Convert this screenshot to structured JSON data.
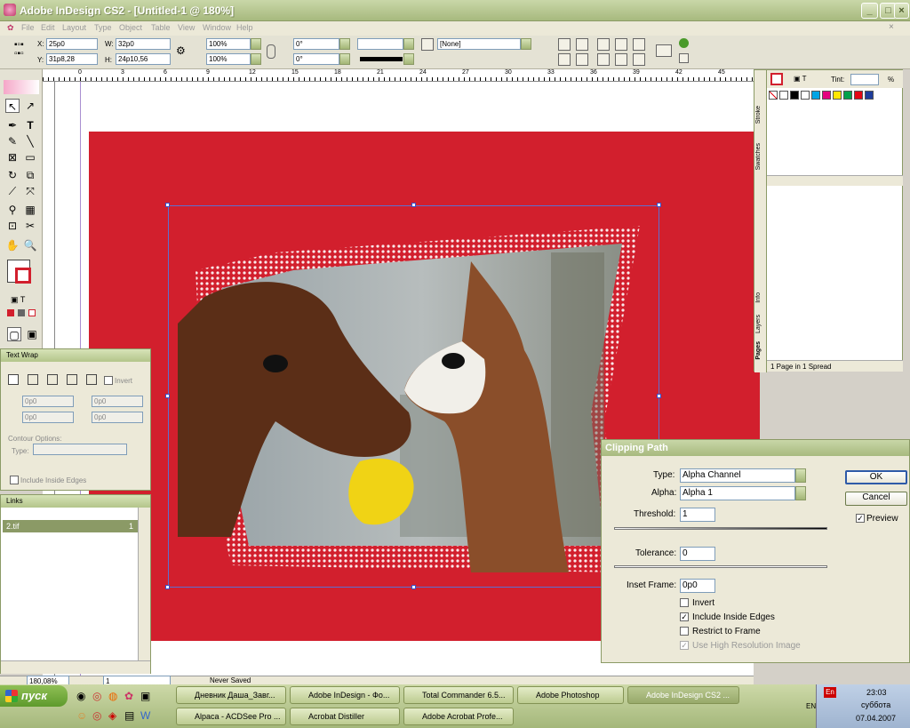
{
  "window": {
    "title": "Adobe InDesign CS2 - [Untitled-1 @ 180%]"
  },
  "menu": [
    "File",
    "Edit",
    "Layout",
    "Type",
    "Object",
    "Table",
    "View",
    "Window",
    "Help"
  ],
  "control": {
    "x_label": "X:",
    "x_value": "25p0",
    "y_label": "Y:",
    "y_value": "31p8,28",
    "w_label": "W:",
    "w_value": "32p0",
    "h_label": "H:",
    "h_value": "24p10,56",
    "scale_x": "100%",
    "scale_y": "100%",
    "rotate": "0°",
    "shear": "0°",
    "style_value": "[None]"
  },
  "ruler_ticks": [
    "0",
    "3",
    "6",
    "9",
    "12",
    "15",
    "18",
    "21",
    "24",
    "27",
    "30",
    "33",
    "36",
    "39",
    "42",
    "45"
  ],
  "swatches": {
    "tint_label": "Tint:",
    "tint_unit": "%",
    "tabs": [
      "Swatches",
      "Stroke",
      "Info",
      "Layers",
      "Pages"
    ],
    "colors": [
      "#ffffff",
      "#000000",
      "#ffffff",
      "#00a5e5",
      "#e5007e",
      "#ffe600",
      "#00a14b",
      "#e30613",
      "#1e3d9b"
    ],
    "footer": "1 Page in 1 Spread"
  },
  "textwrap": {
    "title": "Text Wrap",
    "invert": "Invert",
    "offset1": "0p0",
    "offset2": "0p0",
    "offset3": "0p0",
    "offset4": "0p0",
    "contour_label": "Contour Options:",
    "type_label": "Type:",
    "include_edges": "Include Inside Edges"
  },
  "links": {
    "title": "Links",
    "item_name": "2.tif",
    "item_page": "1"
  },
  "clipping": {
    "title": "Clipping Path",
    "type_label": "Type:",
    "type_value": "Alpha Channel",
    "alpha_label": "Alpha:",
    "alpha_value": "Alpha 1",
    "threshold_label": "Threshold:",
    "threshold_value": "1",
    "tolerance_label": "Tolerance:",
    "tolerance_value": "0",
    "inset_label": "Inset Frame:",
    "inset_value": "0p0",
    "invert": "Invert",
    "include_edges": "Include Inside Edges",
    "restrict": "Restrict to Frame",
    "hires": "Use High Resolution Image",
    "ok": "OK",
    "cancel": "Cancel",
    "preview": "Preview"
  },
  "status": {
    "zoom": "180,08%",
    "page": "1",
    "saved": "Never Saved"
  },
  "taskbar": {
    "start": "пуск",
    "row1": [
      "Дневник Даша_Завг...",
      "Adobe InDesign - Фо...",
      "Total Commander 6.5...",
      "Adobe Photoshop",
      "Adobe InDesign CS2 ..."
    ],
    "row2": [
      "Alpaca - ACDSee Pro ...",
      "Acrobat Distiller",
      "Adobe Acrobat Profe..."
    ],
    "lang": "En",
    "lang2": "EN",
    "time": "23:03",
    "day": "суббота",
    "date": "07.04.2007"
  },
  "colors": {
    "page_red": "#d21f2d",
    "accent_green": "#a7b97e"
  }
}
